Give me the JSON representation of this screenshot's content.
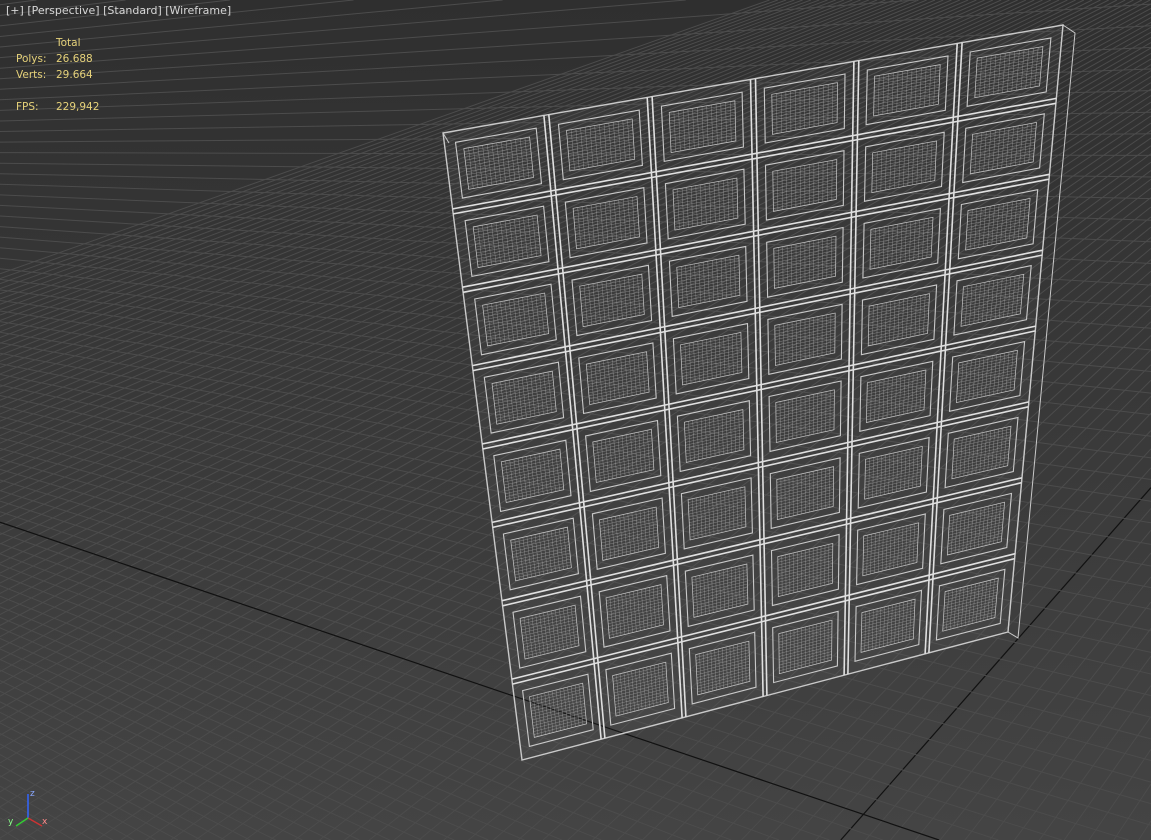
{
  "viewport": {
    "labels": {
      "plus": "[+]",
      "view": "[Perspective]",
      "shading_style": "[Standard]",
      "display_mode": "[Wireframe]"
    },
    "stats": {
      "header": "Total",
      "polys_label": "Polys:",
      "polys_value": "26.688",
      "verts_label": "Verts:",
      "verts_value": "29.664",
      "fps_label": "FPS:",
      "fps_value": "229,942"
    },
    "gizmo": {
      "z": "z",
      "y": "y",
      "x": "x"
    },
    "colors": {
      "stats_text": "#e6d27a",
      "grid_line": "#4c4c4c",
      "grid_axis": "#111111",
      "wire": "#c9c9c9",
      "axis_x": "#cc3333",
      "axis_y": "#33cc33",
      "axis_z": "#3366ff"
    }
  }
}
